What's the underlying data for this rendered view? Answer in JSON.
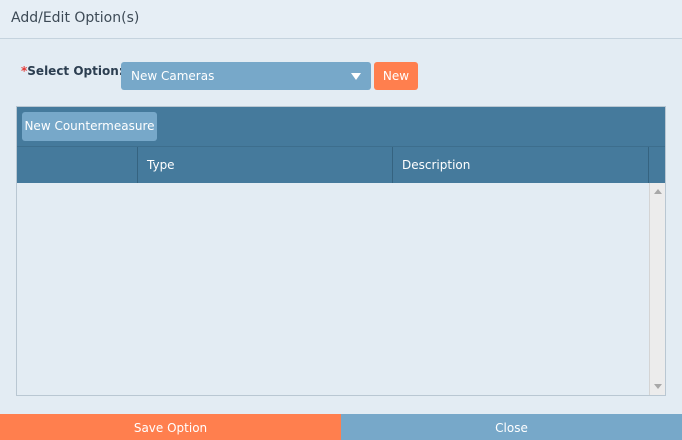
{
  "dialog": {
    "title": "Add/Edit Option(s)"
  },
  "select_option": {
    "required_marker": "*",
    "label": "Select Option:",
    "value": "New Cameras",
    "new_label": "New"
  },
  "grid": {
    "toolbar": {
      "new_countermeasure_label": "New Countermeasure"
    },
    "columns": [
      "",
      "Type",
      "Description"
    ],
    "rows": []
  },
  "footer": {
    "save_label": "Save Option",
    "close_label": "Close"
  },
  "colors": {
    "accent_orange": "#ff7f4e",
    "primary_blue": "#77a8c9",
    "header_blue": "#457a9c",
    "background": "#e3ecf3"
  },
  "icons": {
    "dropdown": "chevron-down-icon",
    "scroll_up": "scroll-up-icon",
    "scroll_down": "scroll-down-icon"
  }
}
